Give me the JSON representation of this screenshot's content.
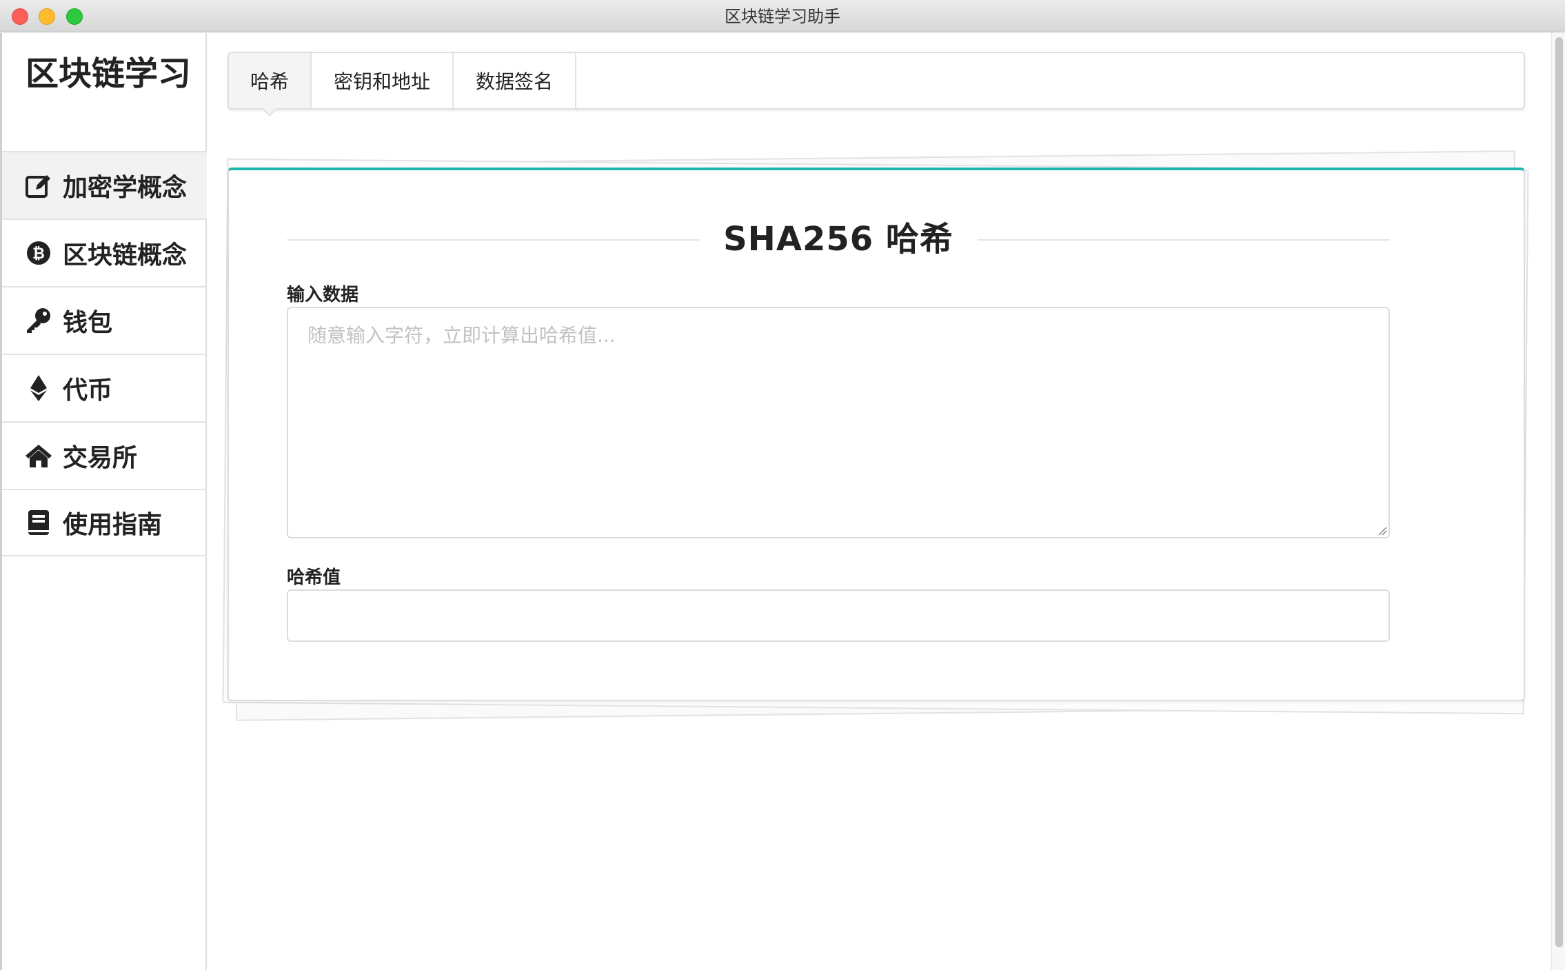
{
  "window": {
    "title": "区块链学习助手"
  },
  "sidebar": {
    "app_name": "区块链学习",
    "items": [
      {
        "label": "加密学概念",
        "icon": "edit-icon",
        "active": true
      },
      {
        "label": "区块链概念",
        "icon": "bitcoin-icon",
        "active": false
      },
      {
        "label": "钱包",
        "icon": "key-icon",
        "active": false
      },
      {
        "label": "代币",
        "icon": "ethereum-icon",
        "active": false
      },
      {
        "label": "交易所",
        "icon": "home-icon",
        "active": false
      },
      {
        "label": "使用指南",
        "icon": "book-icon",
        "active": false
      }
    ]
  },
  "tabs": [
    {
      "label": "哈希",
      "active": true
    },
    {
      "label": "密钥和地址",
      "active": false
    },
    {
      "label": "数据签名",
      "active": false
    }
  ],
  "card": {
    "title": "SHA256 哈希",
    "input_label": "输入数据",
    "input_placeholder": "随意输入字符，立即计算出哈希值...",
    "input_value": "",
    "output_label": "哈希值",
    "output_value": ""
  },
  "colors": {
    "accent": "#1fb5ad",
    "sidebar_active_bg": "#f2f2f2"
  }
}
